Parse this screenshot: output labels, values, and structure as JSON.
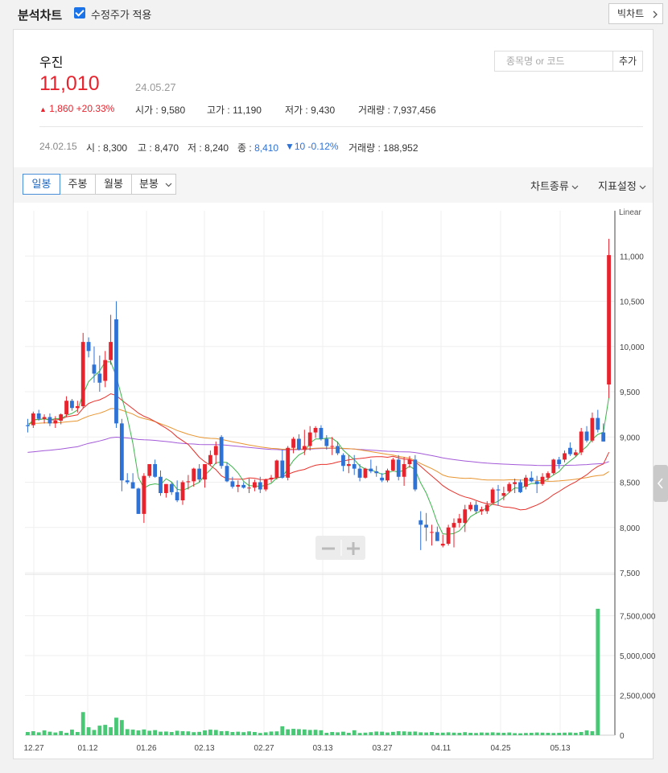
{
  "app": {
    "title": "분석차트",
    "adjusted_label": "수정주가 적용",
    "adjusted_checked": true,
    "bigchart_label": "빅차트"
  },
  "stock": {
    "name": "우진",
    "price": "11,010",
    "date": "24.05.27",
    "change_arrow": "▲",
    "change": "1,860",
    "change_pct": "+20.33%",
    "open_label": "시가",
    "open": "9,580",
    "high_label": "고가",
    "high": "11,190",
    "low_label": "저가",
    "low": "9,430",
    "volume_label": "거래량",
    "volume": "7,937,456"
  },
  "search": {
    "placeholder": "종목명 or 코드",
    "add_label": "추가"
  },
  "history": {
    "date": "24.02.15",
    "open_label": "시",
    "open": "8,300",
    "high_label": "고",
    "high": "8,470",
    "low_label": "저",
    "low": "8,240",
    "close_label": "종",
    "close": "8,410",
    "change": "▼10 -0.12%",
    "volume_label": "거래량",
    "volume": "188,952"
  },
  "toolbar": {
    "tabs": [
      "일봉",
      "주봉",
      "월봉",
      "분봉"
    ],
    "active_tab": 0,
    "chart_type_label": "차트종류",
    "indicator_label": "지표설정"
  },
  "colors": {
    "up": "#e8232d",
    "down": "#2f72d6",
    "ma5": "#3cb44b",
    "ma20": "#e8302a",
    "ma60": "#e89530",
    "ma120": "#a35ad8",
    "vol": "#48c774"
  },
  "icons": [
    "checkbox-icon",
    "chevron-right-icon",
    "chevron-down-icon",
    "chevron-left-icon",
    "zoom-out-icon",
    "zoom-in-icon"
  ],
  "chart_data": {
    "type": "candlestick",
    "scale_label": "Linear",
    "price_ticks": [
      "11,000",
      "10,500",
      "10,000",
      "9,500",
      "9,000",
      "8,500",
      "8,000",
      "7,500"
    ],
    "volume_ticks": [
      "7,500,000",
      "5,000,000",
      "2,500,000",
      "0"
    ],
    "x_ticks": [
      "12.27",
      "01.12",
      "01.26",
      "02.13",
      "02.27",
      "03.13",
      "03.27",
      "04.11",
      "04.25",
      "05.13"
    ],
    "price_range": [
      7500,
      11500
    ],
    "volume_range": [
      0,
      10000000
    ],
    "candles": [
      [
        9130,
        9200,
        9050,
        9120
      ],
      [
        9130,
        9280,
        9100,
        9260
      ],
      [
        9260,
        9300,
        9180,
        9200
      ],
      [
        9200,
        9250,
        9150,
        9220
      ],
      [
        9220,
        9260,
        9120,
        9150
      ],
      [
        9150,
        9230,
        9100,
        9180
      ],
      [
        9180,
        9260,
        9140,
        9250
      ],
      [
        9250,
        9450,
        9220,
        9400
      ],
      [
        9400,
        9420,
        9290,
        9320
      ],
      [
        9320,
        9400,
        9270,
        9340
      ],
      [
        9340,
        10150,
        9320,
        10050
      ],
      [
        10050,
        10100,
        9880,
        9950
      ],
      [
        9800,
        10000,
        9600,
        9700
      ],
      [
        9700,
        9900,
        9500,
        9600
      ],
      [
        9620,
        9950,
        9550,
        9850
      ],
      [
        9850,
        10350,
        9800,
        10050
      ],
      [
        10300,
        10500,
        9100,
        9150
      ],
      [
        9150,
        9200,
        8400,
        8520
      ],
      [
        8520,
        8600,
        8480,
        8500
      ],
      [
        8500,
        8600,
        8430,
        8430
      ],
      [
        8430,
        8440,
        8150,
        8150
      ],
      [
        8150,
        8600,
        8050,
        8570
      ],
      [
        8570,
        8700,
        8550,
        8700
      ],
      [
        8700,
        8750,
        8550,
        8560
      ],
      [
        8560,
        8630,
        8350,
        8380
      ],
      [
        8380,
        8480,
        8330,
        8480
      ],
      [
        8480,
        8500,
        8360,
        8390
      ],
      [
        8390,
        8520,
        8280,
        8300
      ],
      [
        8300,
        8520,
        8250,
        8500
      ],
      [
        8500,
        8580,
        8420,
        8510
      ],
      [
        8510,
        8660,
        8450,
        8650
      ],
      [
        8650,
        8700,
        8500,
        8530
      ],
      [
        8530,
        8700,
        8440,
        8700
      ],
      [
        8700,
        8850,
        8680,
        8800
      ],
      [
        8800,
        8950,
        8700,
        8900
      ],
      [
        9000,
        9020,
        8650,
        8680
      ],
      [
        8680,
        8720,
        8500,
        8510
      ],
      [
        8510,
        8560,
        8430,
        8450
      ],
      [
        8450,
        8520,
        8390,
        8470
      ],
      [
        8470,
        8500,
        8430,
        8440
      ],
      [
        8440,
        8540,
        8380,
        8440
      ],
      [
        8440,
        8530,
        8400,
        8500
      ],
      [
        8500,
        8560,
        8380,
        8420
      ],
      [
        8420,
        8540,
        8400,
        8530
      ],
      [
        8530,
        8580,
        8500,
        8550
      ],
      [
        8550,
        8750,
        8530,
        8740
      ],
      [
        8740,
        8860,
        8540,
        8550
      ],
      [
        8550,
        8900,
        8520,
        8880
      ],
      [
        8880,
        9000,
        8820,
        8980
      ],
      [
        8980,
        9030,
        8850,
        8860
      ],
      [
        8860,
        9080,
        8800,
        8900
      ],
      [
        8900,
        9120,
        8850,
        9050
      ],
      [
        9050,
        9120,
        8990,
        9100
      ],
      [
        9100,
        9130,
        8960,
        8980
      ],
      [
        8980,
        9020,
        8860,
        8900
      ],
      [
        8900,
        9000,
        8800,
        8900
      ],
      [
        8900,
        8950,
        8800,
        8820
      ],
      [
        8800,
        8820,
        8620,
        8680
      ],
      [
        8680,
        8800,
        8600,
        8700
      ],
      [
        8700,
        8800,
        8580,
        8650
      ],
      [
        8650,
        8700,
        8510,
        8550
      ],
      [
        8550,
        8660,
        8540,
        8650
      ],
      [
        8650,
        8750,
        8600,
        8620
      ],
      [
        8620,
        8680,
        8560,
        8600
      ],
      [
        8550,
        8600,
        8500,
        8520
      ],
      [
        8520,
        8650,
        8500,
        8630
      ],
      [
        8630,
        8770,
        8620,
        8750
      ],
      [
        8750,
        8800,
        8520,
        8560
      ],
      [
        8560,
        8780,
        8460,
        8700
      ],
      [
        8700,
        8790,
        8660,
        8750
      ],
      [
        8750,
        8800,
        8400,
        8420
      ],
      [
        8080,
        8180,
        7750,
        8030
      ],
      [
        8030,
        8160,
        7850,
        8000
      ],
      [
        7950,
        8030,
        7800,
        7950
      ],
      [
        7950,
        8010,
        7850,
        7850
      ],
      [
        7800,
        7920,
        7780,
        7820
      ],
      [
        7820,
        8030,
        7800,
        8000
      ],
      [
        8000,
        8100,
        7780,
        8050
      ],
      [
        8050,
        8150,
        8000,
        8100
      ],
      [
        8050,
        8250,
        7950,
        8200
      ],
      [
        8200,
        8280,
        8180,
        8250
      ],
      [
        8250,
        8290,
        8150,
        8180
      ],
      [
        8180,
        8230,
        8140,
        8200
      ],
      [
        8180,
        8290,
        8150,
        8250
      ],
      [
        8270,
        8440,
        8260,
        8420
      ],
      [
        8420,
        8470,
        8240,
        8410
      ],
      [
        8350,
        8450,
        8300,
        8380
      ],
      [
        8400,
        8500,
        8380,
        8480
      ],
      [
        8480,
        8540,
        8380,
        8500
      ],
      [
        8500,
        8530,
        8380,
        8390
      ],
      [
        8450,
        8580,
        8420,
        8550
      ],
      [
        8550,
        8620,
        8500,
        8510
      ],
      [
        8510,
        8570,
        8380,
        8480
      ],
      [
        8480,
        8600,
        8460,
        8560
      ],
      [
        8550,
        8620,
        8520,
        8600
      ],
      [
        8600,
        8760,
        8580,
        8750
      ],
      [
        8750,
        8780,
        8650,
        8700
      ],
      [
        8750,
        8850,
        8720,
        8820
      ],
      [
        8880,
        8940,
        8790,
        8810
      ],
      [
        8800,
        8860,
        8780,
        8830
      ],
      [
        8830,
        9100,
        8800,
        9060
      ],
      [
        9060,
        9120,
        8940,
        8960
      ],
      [
        8960,
        9270,
        8940,
        9210
      ],
      [
        9210,
        9300,
        9050,
        9080
      ],
      [
        9050,
        9150,
        8950,
        8950
      ],
      [
        9580,
        11190,
        9430,
        11010
      ]
    ],
    "volumes": [
      200000,
      250000,
      180000,
      300000,
      220000,
      170000,
      260000,
      150000,
      350000,
      200000,
      1450000,
      500000,
      330000,
      600000,
      650000,
      500000,
      1100000,
      950000,
      380000,
      350000,
      300000,
      360000,
      280000,
      320000,
      220000,
      230000,
      200000,
      280000,
      250000,
      240000,
      190000,
      210000,
      300000,
      350000,
      330000,
      250000,
      260000,
      200000,
      220000,
      190000,
      240000,
      200000,
      140000,
      180000,
      230000,
      240000,
      560000,
      370000,
      400000,
      380000,
      360000,
      330000,
      340000,
      310000,
      150000,
      200000,
      180000,
      220000,
      150000,
      310000,
      140000,
      160000,
      190000,
      230000,
      220000,
      170000,
      210000,
      250000,
      240000,
      220000,
      230000,
      180000,
      170000,
      200000,
      150000,
      160000,
      180000,
      160000,
      150000,
      190000,
      150000,
      140000,
      170000,
      160000,
      180000,
      160000,
      150000,
      170000,
      130000,
      120000,
      140000,
      150000,
      170000,
      160000,
      150000,
      140000,
      150000,
      160000,
      170000,
      150000,
      200000,
      300000,
      250000,
      7937456
    ],
    "moving_averages": [
      "MA5",
      "MA20",
      "MA60",
      "MA120"
    ]
  }
}
